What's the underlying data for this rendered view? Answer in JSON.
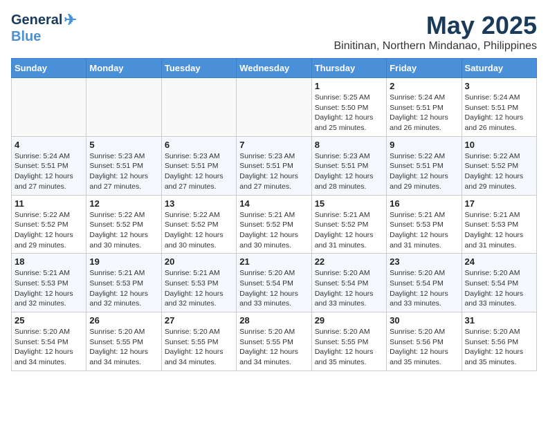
{
  "header": {
    "logo_general": "General",
    "logo_blue": "Blue",
    "month": "May 2025",
    "location": "Binitinan, Northern Mindanao, Philippines"
  },
  "weekdays": [
    "Sunday",
    "Monday",
    "Tuesday",
    "Wednesday",
    "Thursday",
    "Friday",
    "Saturday"
  ],
  "weeks": [
    [
      {
        "day": "",
        "sunrise": "",
        "sunset": "",
        "daylight": ""
      },
      {
        "day": "",
        "sunrise": "",
        "sunset": "",
        "daylight": ""
      },
      {
        "day": "",
        "sunrise": "",
        "sunset": "",
        "daylight": ""
      },
      {
        "day": "",
        "sunrise": "",
        "sunset": "",
        "daylight": ""
      },
      {
        "day": "1",
        "sunrise": "5:25 AM",
        "sunset": "5:50 PM",
        "daylight": "12 hours and 25 minutes."
      },
      {
        "day": "2",
        "sunrise": "5:24 AM",
        "sunset": "5:51 PM",
        "daylight": "12 hours and 26 minutes."
      },
      {
        "day": "3",
        "sunrise": "5:24 AM",
        "sunset": "5:51 PM",
        "daylight": "12 hours and 26 minutes."
      }
    ],
    [
      {
        "day": "4",
        "sunrise": "5:24 AM",
        "sunset": "5:51 PM",
        "daylight": "12 hours and 27 minutes."
      },
      {
        "day": "5",
        "sunrise": "5:23 AM",
        "sunset": "5:51 PM",
        "daylight": "12 hours and 27 minutes."
      },
      {
        "day": "6",
        "sunrise": "5:23 AM",
        "sunset": "5:51 PM",
        "daylight": "12 hours and 27 minutes."
      },
      {
        "day": "7",
        "sunrise": "5:23 AM",
        "sunset": "5:51 PM",
        "daylight": "12 hours and 27 minutes."
      },
      {
        "day": "8",
        "sunrise": "5:23 AM",
        "sunset": "5:51 PM",
        "daylight": "12 hours and 28 minutes."
      },
      {
        "day": "9",
        "sunrise": "5:22 AM",
        "sunset": "5:51 PM",
        "daylight": "12 hours and 29 minutes."
      },
      {
        "day": "10",
        "sunrise": "5:22 AM",
        "sunset": "5:52 PM",
        "daylight": "12 hours and 29 minutes."
      }
    ],
    [
      {
        "day": "11",
        "sunrise": "5:22 AM",
        "sunset": "5:52 PM",
        "daylight": "12 hours and 29 minutes."
      },
      {
        "day": "12",
        "sunrise": "5:22 AM",
        "sunset": "5:52 PM",
        "daylight": "12 hours and 30 minutes."
      },
      {
        "day": "13",
        "sunrise": "5:22 AM",
        "sunset": "5:52 PM",
        "daylight": "12 hours and 30 minutes."
      },
      {
        "day": "14",
        "sunrise": "5:21 AM",
        "sunset": "5:52 PM",
        "daylight": "12 hours and 30 minutes."
      },
      {
        "day": "15",
        "sunrise": "5:21 AM",
        "sunset": "5:52 PM",
        "daylight": "12 hours and 31 minutes."
      },
      {
        "day": "16",
        "sunrise": "5:21 AM",
        "sunset": "5:53 PM",
        "daylight": "12 hours and 31 minutes."
      },
      {
        "day": "17",
        "sunrise": "5:21 AM",
        "sunset": "5:53 PM",
        "daylight": "12 hours and 31 minutes."
      }
    ],
    [
      {
        "day": "18",
        "sunrise": "5:21 AM",
        "sunset": "5:53 PM",
        "daylight": "12 hours and 32 minutes."
      },
      {
        "day": "19",
        "sunrise": "5:21 AM",
        "sunset": "5:53 PM",
        "daylight": "12 hours and 32 minutes."
      },
      {
        "day": "20",
        "sunrise": "5:21 AM",
        "sunset": "5:53 PM",
        "daylight": "12 hours and 32 minutes."
      },
      {
        "day": "21",
        "sunrise": "5:20 AM",
        "sunset": "5:54 PM",
        "daylight": "12 hours and 33 minutes."
      },
      {
        "day": "22",
        "sunrise": "5:20 AM",
        "sunset": "5:54 PM",
        "daylight": "12 hours and 33 minutes."
      },
      {
        "day": "23",
        "sunrise": "5:20 AM",
        "sunset": "5:54 PM",
        "daylight": "12 hours and 33 minutes."
      },
      {
        "day": "24",
        "sunrise": "5:20 AM",
        "sunset": "5:54 PM",
        "daylight": "12 hours and 33 minutes."
      }
    ],
    [
      {
        "day": "25",
        "sunrise": "5:20 AM",
        "sunset": "5:54 PM",
        "daylight": "12 hours and 34 minutes."
      },
      {
        "day": "26",
        "sunrise": "5:20 AM",
        "sunset": "5:55 PM",
        "daylight": "12 hours and 34 minutes."
      },
      {
        "day": "27",
        "sunrise": "5:20 AM",
        "sunset": "5:55 PM",
        "daylight": "12 hours and 34 minutes."
      },
      {
        "day": "28",
        "sunrise": "5:20 AM",
        "sunset": "5:55 PM",
        "daylight": "12 hours and 34 minutes."
      },
      {
        "day": "29",
        "sunrise": "5:20 AM",
        "sunset": "5:55 PM",
        "daylight": "12 hours and 35 minutes."
      },
      {
        "day": "30",
        "sunrise": "5:20 AM",
        "sunset": "5:56 PM",
        "daylight": "12 hours and 35 minutes."
      },
      {
        "day": "31",
        "sunrise": "5:20 AM",
        "sunset": "5:56 PM",
        "daylight": "12 hours and 35 minutes."
      }
    ]
  ],
  "labels": {
    "sunrise_prefix": "Sunrise: ",
    "sunset_prefix": "Sunset: ",
    "daylight_prefix": "Daylight: "
  }
}
